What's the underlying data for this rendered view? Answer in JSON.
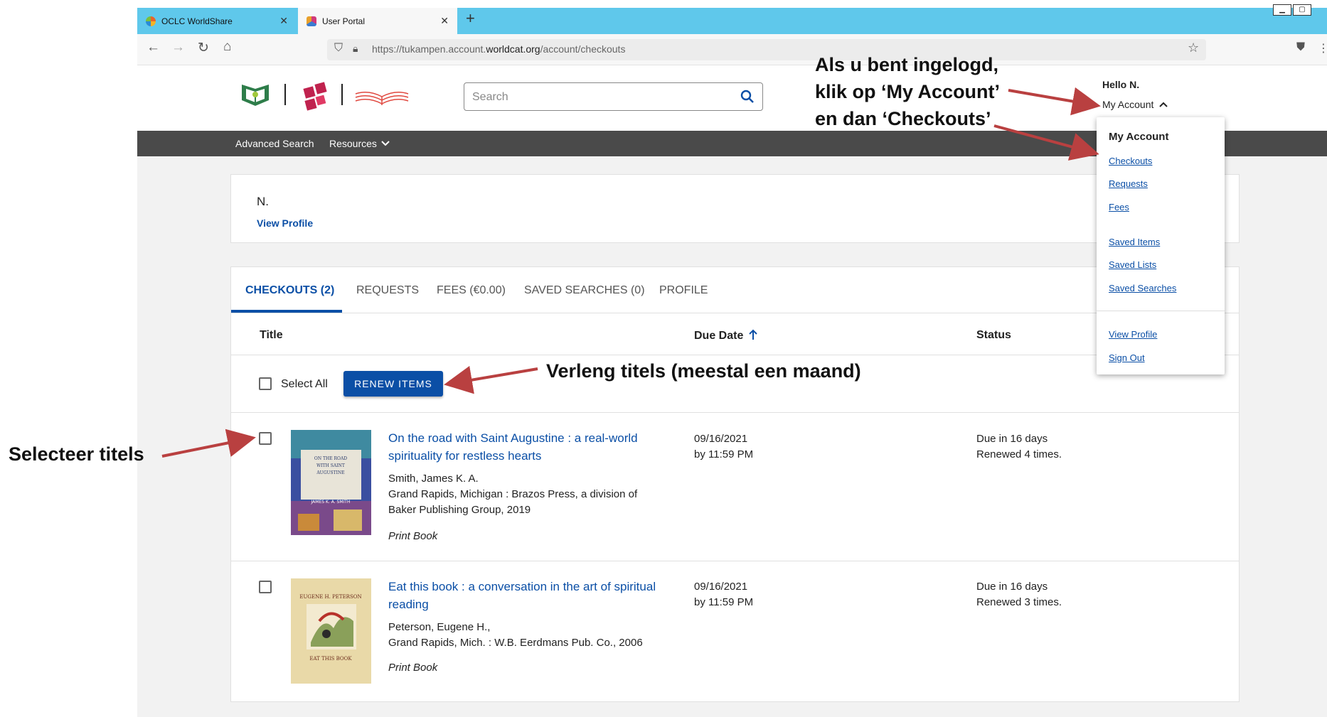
{
  "browser": {
    "tabs": [
      {
        "label": "OCLC WorldShare",
        "close": "✕"
      },
      {
        "label": "User Portal",
        "close": "✕"
      }
    ],
    "new_tab": "+",
    "url_prefix": "https://tukampen.account.",
    "url_domain": "worldcat.org",
    "url_path": "/account/checkouts",
    "window_controls": [
      "▁",
      "▢"
    ]
  },
  "header": {
    "search_placeholder": "Search",
    "greeting": "Hello N.",
    "my_account": "My Account"
  },
  "nav": {
    "advanced_search": "Advanced Search",
    "resources": "Resources"
  },
  "profile": {
    "name": "N.",
    "view_profile": "View Profile"
  },
  "tabs": [
    {
      "label": "CHECKOUTS (2)"
    },
    {
      "label": "REQUESTS"
    },
    {
      "label": "FEES (€0.00)"
    },
    {
      "label": "SAVED SEARCHES (0)"
    },
    {
      "label": "PROFILE"
    }
  ],
  "table": {
    "col_title": "Title",
    "col_due": "Due Date",
    "col_status": "Status",
    "select_all": "Select All",
    "renew_button": "RENEW ITEMS"
  },
  "items": [
    {
      "title_line1": "On the road with Saint Augustine : a real-world",
      "title_line2": "spirituality for restless hearts",
      "author": "Smith, James K. A.",
      "publisher_line1": "Grand Rapids, Michigan : Brazos Press, a division of",
      "publisher_line2": "Baker Publishing Group, 2019",
      "format": "Print Book",
      "due_date": "09/16/2021",
      "due_time": "by 11:59 PM",
      "status_due": "Due in 16 days",
      "status_renewed": "Renewed 4 times."
    },
    {
      "title_line1": "Eat this book : a conversation in the art of spiritual",
      "title_line2": "reading",
      "author": "Peterson, Eugene H.,",
      "publisher_line1": "Grand Rapids, Mich. : W.B. Eerdmans Pub. Co., 2006",
      "publisher_line2": "",
      "format": "Print Book",
      "due_date": "09/16/2021",
      "due_time": "by 11:59 PM",
      "status_due": "Due in 16 days",
      "status_renewed": "Renewed 3 times."
    }
  ],
  "dropdown": {
    "title": "My Account",
    "items": [
      "Checkouts",
      "Requests",
      "Fees",
      "Saved Items",
      "Saved Lists",
      "Saved Searches",
      "View Profile",
      "Sign Out"
    ]
  },
  "annotations": {
    "login": [
      "Als u bent ingelogd,",
      "klik op ‘My Account’",
      "en dan ‘Checkouts’"
    ],
    "renew": "Verleng titels (meestal een maand)",
    "select": "Selecteer titels"
  },
  "colors": {
    "accent": "#0b4fa6",
    "tabbar": "#5fc8eb",
    "darknav": "#4a4a4a",
    "arrow": "#b94040"
  }
}
